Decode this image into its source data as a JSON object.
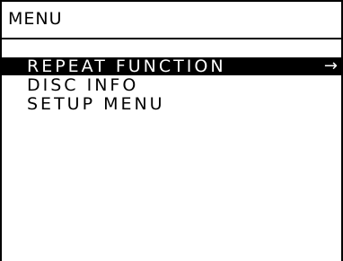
{
  "screen": {
    "title": "MENU"
  },
  "menu": {
    "items": [
      {
        "label": "REPEAT FUNCTION",
        "selected": true,
        "submenu_arrow": "→"
      },
      {
        "label": "DISC INFO",
        "selected": false
      },
      {
        "label": "SETUP MENU",
        "selected": false
      }
    ]
  },
  "colors": {
    "highlight_bg": "#000000",
    "highlight_fg": "#ffffff",
    "background": "#ffffff",
    "text": "#000000"
  }
}
